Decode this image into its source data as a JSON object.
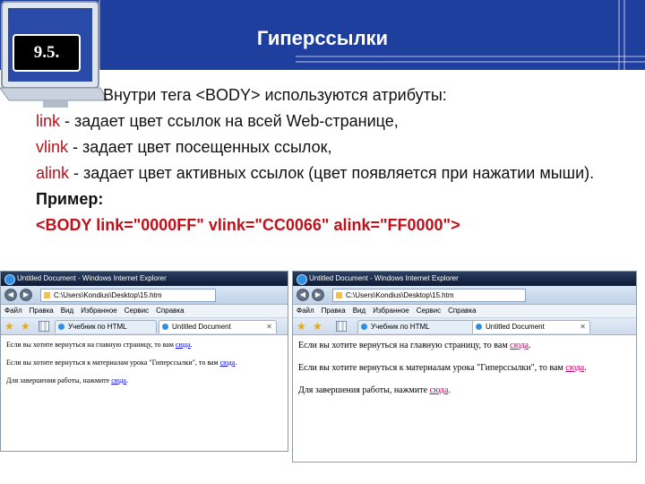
{
  "slide": {
    "number": "9.5.",
    "title": "Гиперссылки"
  },
  "body": {
    "intro": "Внутри тега <BODY> используются атрибуты:",
    "items": [
      {
        "attr": "link",
        "text": " - задает цвет ссылок на всей Web-странице,"
      },
      {
        "attr": "vlink",
        "text": " - задает цвет посещенных ссылок,"
      },
      {
        "attr": "alink",
        "text": " - задает цвет активных ссылок (цвет появляется при нажатии мыши)."
      }
    ],
    "example_label": "Пример:",
    "example_code": "<BODY link=\"0000FF\" vlink=\"CC0066\" alink=\"FF0000\">"
  },
  "browser_left": {
    "title": "Untitled Document - Windows Internet Explorer",
    "address": "C:\\Users\\Kondius\\Desktop\\15.htm",
    "menu": [
      "Файл",
      "Правка",
      "Вид",
      "Избранное",
      "Сервис",
      "Справка"
    ],
    "tabs": [
      "Учебник по HTML",
      "Untitled Document"
    ],
    "lines": [
      {
        "text": "Если вы хотите вернуться на главную страницу, то вам ",
        "link": "сюда",
        "end": "."
      },
      {
        "text": "Если вы хотите вернуться к материалам урока \"Гиперссылки\", то вам ",
        "link": "сюда",
        "end": "."
      },
      {
        "text": "Для завершения работы, нажмите ",
        "link": "сюда",
        "end": "."
      }
    ]
  },
  "browser_right": {
    "title": "Untitled Document - Windows Internet Explorer",
    "address": "C:\\Users\\Kondius\\Desktop\\15.htm",
    "menu": [
      "Файл",
      "Правка",
      "Вид",
      "Избранное",
      "Сервис",
      "Справка"
    ],
    "tabs": [
      "Учебник по HTML",
      "Untitled Document"
    ],
    "lines": [
      {
        "text": "Если вы хотите вернуться на главную страницу, то вам ",
        "link": "сюда",
        "end": "."
      },
      {
        "text": "Если вы хотите вернуться к материалам урока \"Гиперссылки\", то вам ",
        "link": "сюда",
        "end": "."
      },
      {
        "text": "Для завершения работы, нажмите ",
        "link": "сюда",
        "end": "."
      }
    ]
  },
  "colors": {
    "header": "#1e3f9e",
    "attr_red": "#c0101a",
    "visited_link": "#cc0066",
    "new_link": "#0000ff"
  },
  "icons": [
    "monitor-icon",
    "ie-icon",
    "back-icon",
    "forward-icon",
    "page-icon",
    "favorites-star-icon",
    "add-favorite-icon",
    "tab-grid-icon",
    "close-icon"
  ]
}
